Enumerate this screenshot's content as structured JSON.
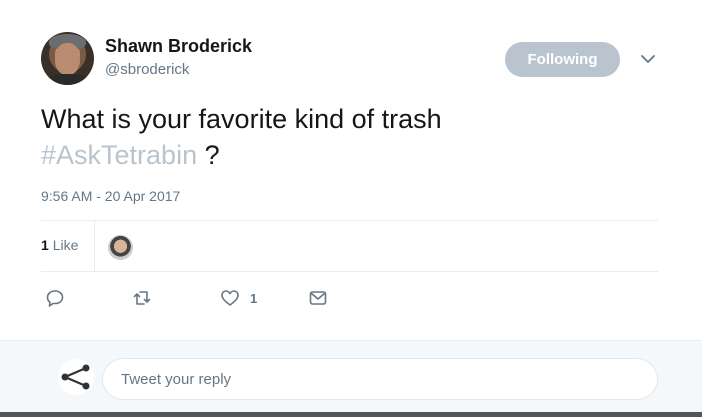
{
  "author": {
    "name": "Shawn Broderick",
    "handle": "@sbroderick"
  },
  "follow_button": {
    "label": "Following"
  },
  "tweet": {
    "text": "What is your favorite kind of trash",
    "hashtag": "#AskTetrabin",
    "text_suffix": " ?",
    "timestamp": "9:56 AM - 20 Apr 2017"
  },
  "stats": {
    "like_count": "1",
    "like_label": "Like"
  },
  "actions": {
    "like_count": "1"
  },
  "reply": {
    "placeholder": "Tweet your reply"
  },
  "colors": {
    "following_bg": "#b9c4ce",
    "hashtag": "#b9c4ce",
    "secondary_text": "#657786",
    "reply_bg": "#f5f8fa"
  },
  "icons": [
    "chevron-down-icon",
    "reply-icon",
    "retweet-icon",
    "heart-icon",
    "envelope-icon",
    "share-node-icon"
  ]
}
